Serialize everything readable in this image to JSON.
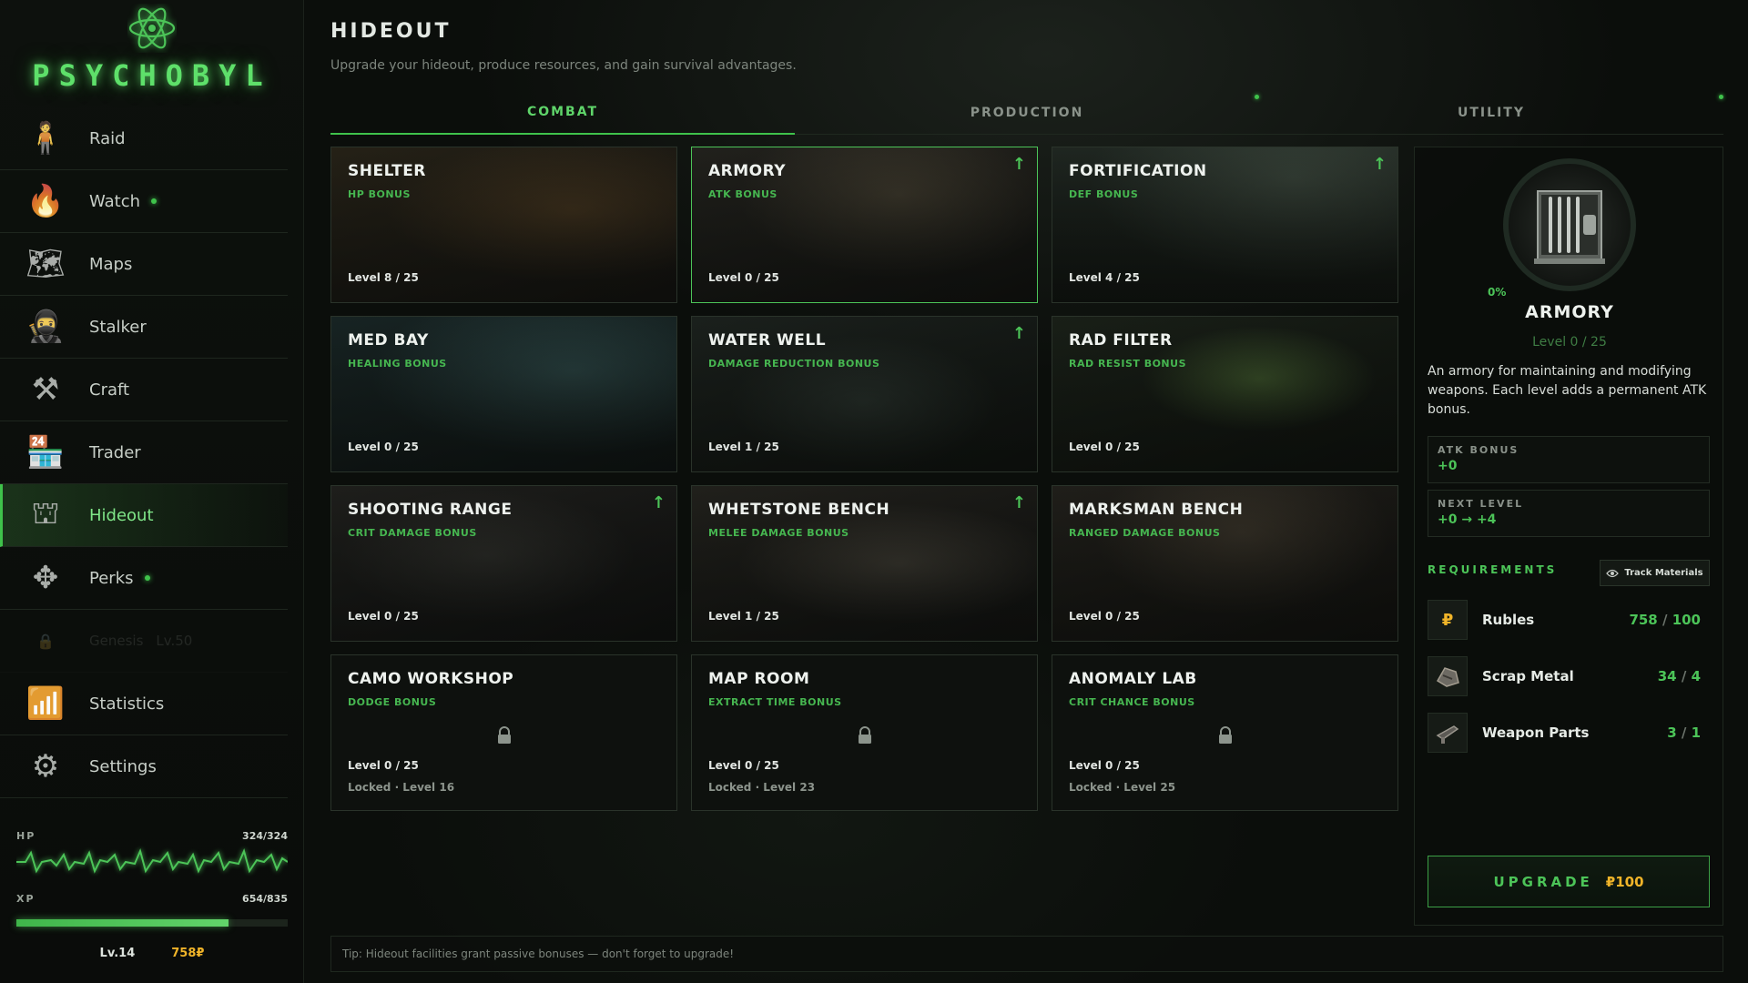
{
  "app": {
    "logo_text": "PSYCHOBYL",
    "accent_color": "#4cc458",
    "currency_color": "#f0b429"
  },
  "sidebar": {
    "items": [
      {
        "label": "Raid",
        "icon": "raid-stalker-icon",
        "dot": false
      },
      {
        "label": "Watch",
        "icon": "campfire-icon",
        "dot": true
      },
      {
        "label": "Maps",
        "icon": "map-icon",
        "dot": false
      },
      {
        "label": "Stalker",
        "icon": "hooded-stalker-icon",
        "dot": false
      },
      {
        "label": "Craft",
        "icon": "anvil-icon",
        "dot": false
      },
      {
        "label": "Trader",
        "icon": "trader-booth-icon",
        "dot": false
      },
      {
        "label": "Hideout",
        "icon": "bunker-icon",
        "dot": false,
        "active": true
      },
      {
        "label": "Perks",
        "icon": "perk-tree-icon",
        "dot": true
      },
      {
        "label": "Genesis",
        "icon": "lock-icon",
        "locked": true,
        "lock_level": "Lv.50"
      },
      {
        "label": "Statistics",
        "icon": "bar-chart-icon",
        "dot": false
      },
      {
        "label": "Settings",
        "icon": "gear-icon",
        "dot": false
      }
    ],
    "stats": {
      "hp_label": "HP",
      "hp_value": "324/324",
      "xp_label": "XP",
      "xp_value": "654/835",
      "xp_fraction": 0.783,
      "level": "Lv.14",
      "rubles": "758₽"
    }
  },
  "header": {
    "title": "HIDEOUT",
    "subtitle": "Upgrade your hideout, produce resources, and gain survival advantages."
  },
  "tabs": [
    {
      "label": "COMBAT",
      "active": true,
      "dot": false
    },
    {
      "label": "PRODUCTION",
      "active": false,
      "dot": true
    },
    {
      "label": "UTILITY",
      "active": false,
      "dot": true
    }
  ],
  "facilities": [
    {
      "name": "SHELTER",
      "bonus": "HP BONUS",
      "level": "Level 8 / 25",
      "upgradable": false,
      "locked": false,
      "scene": "shelter"
    },
    {
      "name": "ARMORY",
      "bonus": "ATK BONUS",
      "level": "Level 0 / 25",
      "upgradable": true,
      "locked": false,
      "selected": true,
      "scene": "armory"
    },
    {
      "name": "FORTIFICATION",
      "bonus": "DEF BONUS",
      "level": "Level 4 / 25",
      "upgradable": true,
      "locked": false,
      "scene": "fortification"
    },
    {
      "name": "MED BAY",
      "bonus": "HEALING BONUS",
      "level": "Level 0 / 25",
      "upgradable": false,
      "locked": false,
      "scene": "medbay"
    },
    {
      "name": "WATER WELL",
      "bonus": "DAMAGE REDUCTION BONUS",
      "level": "Level 1 / 25",
      "upgradable": true,
      "locked": false,
      "scene": "well"
    },
    {
      "name": "RAD FILTER",
      "bonus": "RAD RESIST BONUS",
      "level": "Level 0 / 25",
      "upgradable": false,
      "locked": false,
      "scene": "radfilter"
    },
    {
      "name": "SHOOTING RANGE",
      "bonus": "CRIT DAMAGE BONUS",
      "level": "Level 0 / 25",
      "upgradable": true,
      "locked": false,
      "scene": "range"
    },
    {
      "name": "WHETSTONE BENCH",
      "bonus": "MELEE DAMAGE BONUS",
      "level": "Level 1 / 25",
      "upgradable": true,
      "locked": false,
      "scene": "whetstone"
    },
    {
      "name": "MARKSMAN BENCH",
      "bonus": "RANGED DAMAGE BONUS",
      "level": "Level 0 / 25",
      "upgradable": false,
      "locked": false,
      "scene": "marksman"
    },
    {
      "name": "CAMO WORKSHOP",
      "bonus": "DODGE BONUS",
      "level": "Level 0 / 25",
      "upgradable": false,
      "locked": true,
      "lock_text": "Locked · Level 16"
    },
    {
      "name": "MAP ROOM",
      "bonus": "EXTRACT TIME BONUS",
      "level": "Level 0 / 25",
      "upgradable": false,
      "locked": true,
      "lock_text": "Locked · Level 23"
    },
    {
      "name": "ANOMALY LAB",
      "bonus": "CRIT CHANCE BONUS",
      "level": "Level 0 / 25",
      "upgradable": false,
      "locked": true,
      "lock_text": "Locked · Level 25"
    }
  ],
  "detail": {
    "progress": "0%",
    "name": "ARMORY",
    "level": "Level 0 / 25",
    "description": "An armory for maintaining and modifying weapons. Each level adds a permanent ATK bonus.",
    "bonus_label": "ATK BONUS",
    "bonus_value": "+0",
    "next_label": "NEXT LEVEL",
    "next_value": "+0 → +4",
    "requirements_label": "REQUIREMENTS",
    "track_label": "Track Materials",
    "requirements": [
      {
        "name": "Rubles",
        "have": "758",
        "need": "100",
        "icon": "ruble-icon"
      },
      {
        "name": "Scrap Metal",
        "have": "34",
        "need": "4",
        "icon": "scrap-metal-icon"
      },
      {
        "name": "Weapon Parts",
        "have": "3",
        "need": "1",
        "icon": "weapon-parts-icon"
      }
    ],
    "upgrade_label": "UPGRADE",
    "upgrade_cost": "₽100"
  },
  "tip": "Tip: Hideout facilities grant passive bonuses — don't forget to upgrade!"
}
